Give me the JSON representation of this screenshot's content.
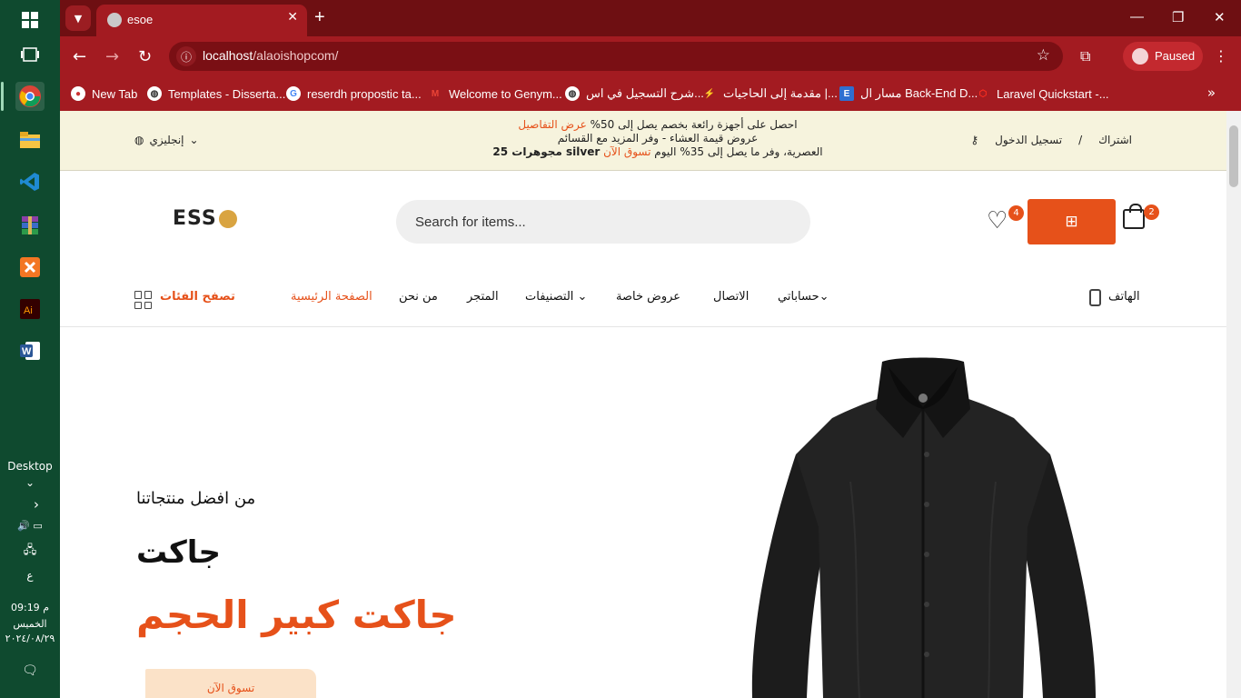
{
  "taskbar": {
    "desktop_label": "Desktop",
    "time": "09:19 م",
    "day": "الخميس",
    "date": "٢٠٢٤/٠٨/٢٩",
    "lang_indicator": "ع"
  },
  "browser": {
    "tab_title": "esoe",
    "url_host": "localhost",
    "url_path": "/alaoishopcom/",
    "profile_status": "Paused",
    "bookmarks": [
      "New Tab",
      "Templates - Disserta...",
      "reserdh propostic ta...",
      "Welcome to Genym...",
      "شرح التسجيل في اس...",
      "مقدمة إلى الحاجيات |...",
      "مسار ال Back-End D...",
      "Laravel Quickstart -..."
    ]
  },
  "topbar": {
    "language": "إنجليزي",
    "promo_line1_pre": "احصل على أجهزة رائعة بخصم يصل إلى 50%",
    "promo_line1_link": "عرض التفاصيل",
    "promo_line2": "عروض قيمة العشاء - وفر المزيد مع القسائم",
    "promo_line3_pre": "العصرية، وفر ما يصل إلى 35% اليوم",
    "promo_line3_link": "تسوق الآن",
    "promo_line3_post": "silver مجوهرات 25",
    "login": "تسجيل الدخول",
    "separator": "/",
    "register": "اشتراك"
  },
  "header": {
    "logo_text": "ESS",
    "search_placeholder": "Search for items...",
    "wishlist_count": "4",
    "cart_count": "2"
  },
  "nav": {
    "browse_categories": "تصفح الفئات",
    "items": [
      "الصفحة الرئيسية",
      "من نحن",
      "المتجر",
      "التصنيفات",
      "عروض خاصة",
      "الاتصال",
      "حساباتي"
    ],
    "phone_label": "الهاتف"
  },
  "hero": {
    "kicker": "من افضل منتجاتنا",
    "title": "جاكت",
    "subtitle": "جاكت كبير الحجم",
    "cta": "تسوق الآن"
  },
  "colors": {
    "accent": "#e6511a",
    "chrome_dark": "#6e0f12",
    "chrome": "#a31b21",
    "taskbar": "#0f4a2f",
    "topbar_bg": "#f6f3dd"
  }
}
